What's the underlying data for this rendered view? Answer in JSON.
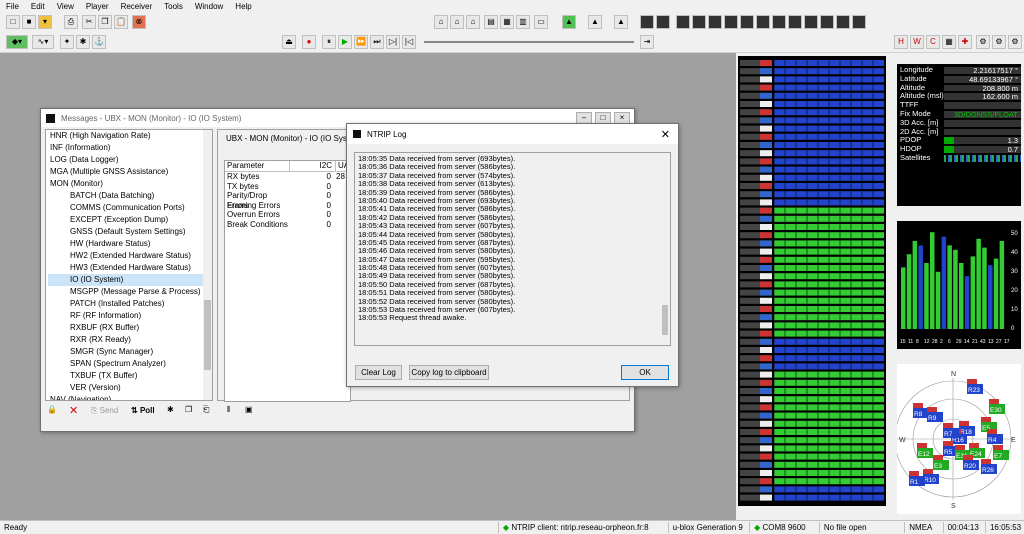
{
  "menu": [
    "File",
    "Edit",
    "View",
    "Player",
    "Receiver",
    "Tools",
    "Window",
    "Help"
  ],
  "messages_window": {
    "title": "Messages - UBX - MON (Monitor) - IO (IO System)",
    "tree": [
      "HNR (High Navigation Rate)",
      "INF (Information)",
      "LOG (Data Logger)",
      "MGA (Multiple GNSS Assistance)",
      "MON (Monitor)",
      "BATCH (Data Batching)",
      "COMMS (Communication Ports)",
      "EXCEPT (Exception Dump)",
      "GNSS (Default System Settings)",
      "HW (Hardware Status)",
      "HW2 (Extended Hardware Status)",
      "HW3 (Extended Hardware Status)",
      "IO (IO System)",
      "MSGPP (Message Parse & Process)",
      "PATCH (Installed Patches)",
      "RF (RF Information)",
      "RXBUF (RX Buffer)",
      "RXR (RX Ready)",
      "SMGR (Sync Manager)",
      "SPAN (Spectrum Analyzer)",
      "TXBUF (TX Buffer)",
      "VER (Version)",
      "NAV (Navigation)"
    ],
    "panel_title": "UBX - MON (Monitor) - IO (IO System)",
    "table_headers": [
      "Parameter",
      "I2C",
      "UA"
    ],
    "table_rows": [
      [
        "RX bytes",
        "0",
        "28"
      ],
      [
        "TX bytes",
        "0",
        ""
      ],
      [
        "Parity/Drop Errors",
        "0",
        ""
      ],
      [
        "Framing Errors",
        "0",
        ""
      ],
      [
        "Overrun Errors",
        "0",
        ""
      ],
      [
        "Break Conditions",
        "0",
        ""
      ]
    ],
    "send_label": "Send",
    "poll_label": "Poll"
  },
  "ntrip_log": {
    "title": "NTRIP Log",
    "lines": [
      "18:05:35  Data received from server (693bytes).",
      "18:05:36  Data received from server (586bytes).",
      "18:05:37  Data received from server (574bytes).",
      "18:05:38  Data received from server (613bytes).",
      "18:05:39  Data received from server (586bytes).",
      "18:05:40  Data received from server (693bytes).",
      "18:05:41  Data received from server (586bytes).",
      "18:05:42  Data received from server (586bytes).",
      "18:05:43  Data received from server (607bytes).",
      "18:05:44  Data received from server (580bytes).",
      "18:05:45  Data received from server (687bytes).",
      "18:05:46  Data received from server (580bytes).",
      "18:05:47  Data received from server (595bytes).",
      "18:05:48  Data received from server (607bytes).",
      "18:05:49  Data received from server (580bytes).",
      "18:05:50  Data received from server (687bytes).",
      "18:05:51  Data received from server (580bytes).",
      "18:05:52  Data received from server (580bytes).",
      "18:05:53  Data received from server (607bytes).",
      "18:05:53  Request thread awake."
    ],
    "clear_label": "Clear Log",
    "copy_label": "Copy log to clipboard",
    "ok_label": "OK"
  },
  "nav_info": {
    "rows": [
      [
        "Longitude",
        "2.21617517 °"
      ],
      [
        "Latitude",
        "48.69133967 °"
      ],
      [
        "Altitude",
        "208.800 m"
      ],
      [
        "Altitude (msl)",
        "162.600 m"
      ],
      [
        "TTFF",
        ""
      ],
      [
        "Fix Mode",
        "3D/DGNSS/FLOAT"
      ],
      [
        "3D Acc. [m]",
        ""
      ],
      [
        "2D Acc. [m]",
        ""
      ],
      [
        "PDOP",
        "1.3"
      ],
      [
        "HDOP",
        "0.7"
      ],
      [
        "Satellites",
        ""
      ]
    ],
    "scale_max": "5",
    "fix_color": "#00c000"
  },
  "cn0_chart": {
    "y_ticks": [
      "50",
      "40",
      "30",
      "20",
      "10",
      "0"
    ],
    "sat_labels": [
      "15",
      "11",
      "8",
      "12",
      "28",
      "2",
      "6",
      "29",
      "14",
      "21",
      "43",
      "13",
      "27",
      "17"
    ]
  },
  "skyview": {
    "north": "N",
    "south": "S",
    "west": "W",
    "east": "E",
    "sats": [
      "R23",
      "E30",
      "R8",
      "R9",
      "E5",
      "R18",
      "R16",
      "E12",
      "R5",
      "E31",
      "E24",
      "E7",
      "R10",
      "R1",
      "R26",
      "E3",
      "R20",
      "R7",
      "R4"
    ]
  },
  "status": {
    "ready": "Ready",
    "ntrip": "NTRIP client: ntrip.reseau-orpheon.fr:8",
    "generation": "u-blox Generation 9",
    "port": "COM8 9600",
    "file": "No file open",
    "protocol": "NMEA",
    "elapsed": "00:04:13",
    "clock": "16:05:53"
  }
}
